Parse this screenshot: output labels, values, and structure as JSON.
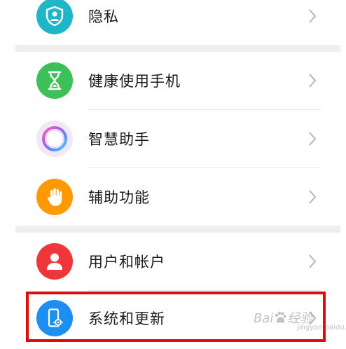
{
  "settings": {
    "items": [
      {
        "label": "隐私",
        "icon": "privacy-shield-icon",
        "color": "#1fb7c7"
      },
      {
        "label": "健康使用手机",
        "icon": "hourglass-icon",
        "color": "#3cc05a"
      },
      {
        "label": "智慧助手",
        "icon": "smart-assistant-ring-icon",
        "color": "#f1e8f7"
      },
      {
        "label": "辅助功能",
        "icon": "hand-icon",
        "color": "#ff9900"
      },
      {
        "label": "用户和帐户",
        "icon": "user-icon",
        "color": "#f0353b"
      },
      {
        "label": "系统和更新",
        "icon": "phone-settings-icon",
        "color": "#1d8ef2"
      }
    ]
  },
  "highlight_color": "#e00b0b",
  "watermark": {
    "text": "Bai",
    "tail": "经验",
    "sub": "jingyan.baidu.com"
  }
}
